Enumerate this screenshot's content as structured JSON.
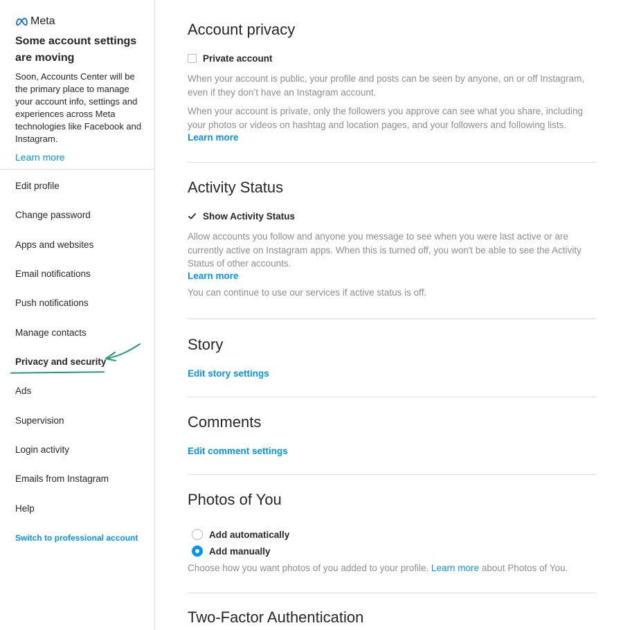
{
  "sidebar": {
    "meta_card": {
      "logo_text": "Meta",
      "title": "Some account settings are moving",
      "description": "Soon, Accounts Center will be the primary place to manage your account info, settings and experiences across Meta technologies like Facebook and Instagram.",
      "learn_more": "Learn more"
    },
    "items": [
      {
        "label": "Edit profile"
      },
      {
        "label": "Change password"
      },
      {
        "label": "Apps and websites"
      },
      {
        "label": "Email notifications"
      },
      {
        "label": "Push notifications"
      },
      {
        "label": "Manage contacts"
      },
      {
        "label": "Privacy and security",
        "active": true
      },
      {
        "label": "Ads"
      },
      {
        "label": "Supervision"
      },
      {
        "label": "Login activity"
      },
      {
        "label": "Emails from Instagram"
      },
      {
        "label": "Help"
      }
    ],
    "professional_link": "Switch to professional account"
  },
  "main": {
    "account_privacy": {
      "title": "Account privacy",
      "checkbox_label": "Private account",
      "checked": false,
      "para1": "When your account is public, your profile and posts can be seen by anyone, on or off Instagram, even if they don’t have an Instagram account.",
      "para2": "When your account is private, only the followers you approve can see what you share, including your photos or videos on hashtag and location pages, and your followers and following lists.",
      "learn_more": "Learn more"
    },
    "activity_status": {
      "title": "Activity Status",
      "checkbox_label": "Show Activity Status",
      "checked": true,
      "para1": "Allow accounts you follow and anyone you message to see when you were last active or are currently active on Instagram apps. When this is turned off, you won't be able to see the Activity Status of other accounts.",
      "learn_more": "Learn more",
      "para2": "You can continue to use our services if active status is off."
    },
    "story": {
      "title": "Story",
      "link": "Edit story settings"
    },
    "comments": {
      "title": "Comments",
      "link": "Edit comment settings"
    },
    "photos_of_you": {
      "title": "Photos of You",
      "options": [
        {
          "label": "Add automatically",
          "selected": false
        },
        {
          "label": "Add manually",
          "selected": true
        }
      ],
      "help_text": "Choose how you want photos of you added to your profile.",
      "learn_more": "Learn more",
      "help_suffix": "about Photos of You."
    },
    "two_factor": {
      "title": "Two-Factor Authentication"
    }
  },
  "colors": {
    "accent": "#0095f6",
    "annotation": "#1f9c7c",
    "muted_text": "#8e8e8e",
    "border": "#dbdbdb"
  }
}
